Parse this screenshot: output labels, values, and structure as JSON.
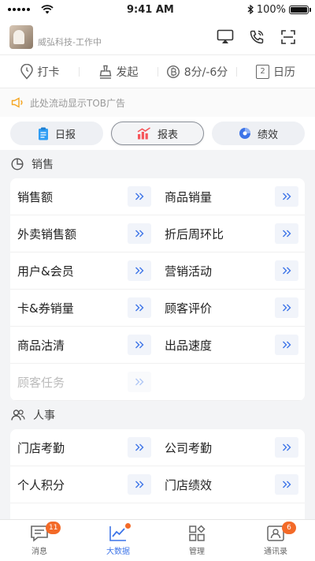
{
  "status": {
    "time": "9:41 AM",
    "battery": "100%"
  },
  "header": {
    "brand": "威弘科技-工作中"
  },
  "quick": [
    {
      "label": "打卡"
    },
    {
      "label": "发起"
    },
    {
      "label": "8分/-6分"
    },
    {
      "label": "日历",
      "calendar_num": "2"
    }
  ],
  "ad": {
    "text": "此处流动显示TOB广告"
  },
  "tabs": [
    {
      "label": "日报"
    },
    {
      "label": "报表"
    },
    {
      "label": "绩效"
    }
  ],
  "sales": {
    "title": "销售",
    "items": [
      "销售额",
      "商品销量",
      "外卖销售额",
      "折后周环比",
      "用户&会员",
      "营销活动",
      "卡&券销量",
      "顾客评价",
      "商品沽清",
      "出品速度",
      "顾客任务"
    ]
  },
  "hr": {
    "title": "人事",
    "items": [
      "门店考勤",
      "公司考勤",
      "个人积分",
      "门店绩效"
    ]
  },
  "arrow": "»",
  "nav": [
    {
      "label": "消息",
      "badge": "11"
    },
    {
      "label": "大数据"
    },
    {
      "label": "管理"
    },
    {
      "label": "通讯录",
      "badge": "6"
    }
  ],
  "colors": {
    "accent": "#3d74e8",
    "badge": "#f36a28",
    "ad_icon": "#f5a623"
  }
}
